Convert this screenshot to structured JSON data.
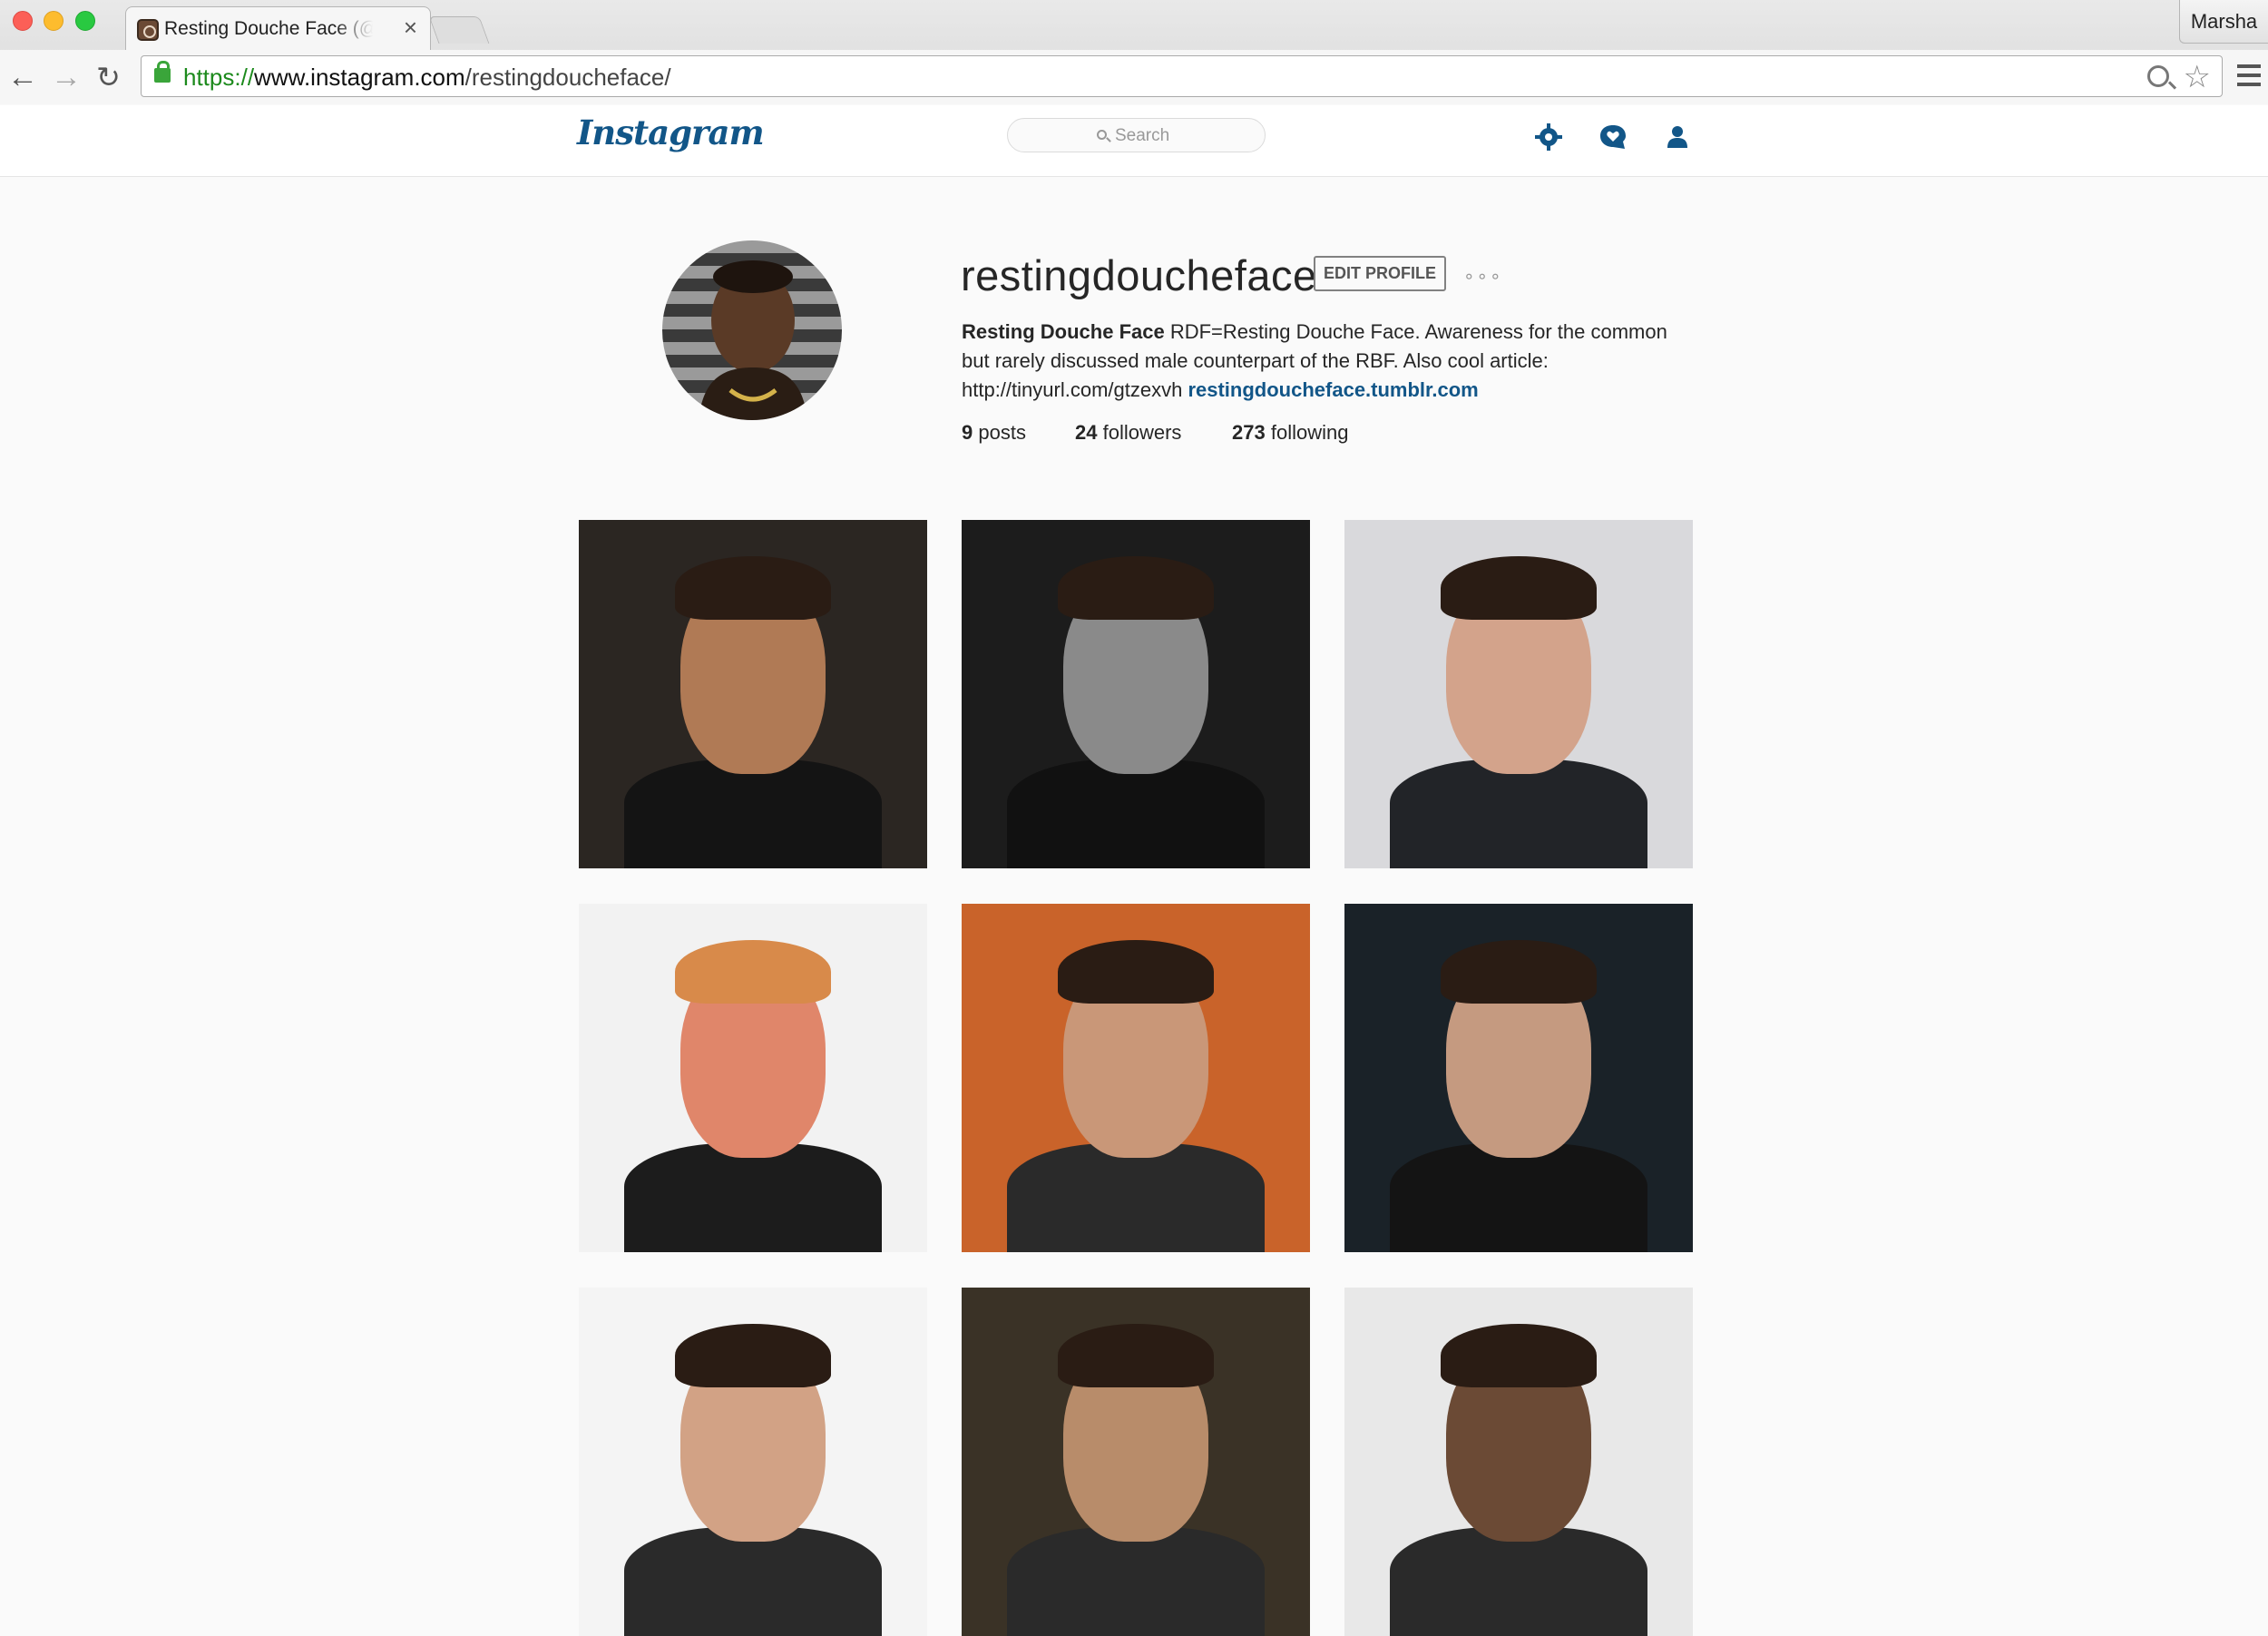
{
  "browser": {
    "tab_title": "Resting Douche Face (@restingdoucheface)",
    "tab_close": "×",
    "profile_name": "Marsha",
    "url": {
      "scheme": "https://",
      "host": "www.instagram.com",
      "path": "/restingdoucheface/"
    },
    "icons": [
      "back-icon",
      "forward-icon",
      "reload-icon",
      "lock-icon",
      "zoom-icon",
      "star-icon",
      "menu-icon"
    ]
  },
  "header": {
    "logo": "Instagram",
    "search_placeholder": "Search",
    "icons": [
      "explore-icon",
      "activity-icon",
      "profile-icon"
    ],
    "accent_color": "#125688"
  },
  "profile": {
    "username": "restingdoucheface",
    "edit_label": "EDIT PROFILE",
    "options": "∘∘∘",
    "bio_name": "Resting Douche Face",
    "bio_text": "RDF=Resting Douche Face. Awareness for the common but rarely discussed male counterpart of the RBF. Also cool article: http://tinyurl.com/gtzexvh",
    "bio_link": "restingdoucheface.tumblr.com",
    "stats": [
      {
        "count": "9",
        "label": "posts"
      },
      {
        "count": "24",
        "label": "followers"
      },
      {
        "count": "273",
        "label": "following"
      }
    ]
  },
  "posts": [
    {
      "name": "post-1",
      "bg": "#2b2622",
      "skin": "#b07a55",
      "suit": "#141414"
    },
    {
      "name": "post-2",
      "bg": "#1c1c1c",
      "skin": "#8a8a8a",
      "suit": "#111111"
    },
    {
      "name": "post-3",
      "bg": "#d9d9dc",
      "skin": "#d3a38b",
      "suit": "#222428"
    },
    {
      "name": "post-4",
      "bg": "#f2f2f2",
      "skin": "#e0866a",
      "suit": "#1c1c1c"
    },
    {
      "name": "post-5",
      "bg": "#c9632a",
      "skin": "#c99778",
      "suit": "#2a2a2a"
    },
    {
      "name": "post-6",
      "bg": "#1a2228",
      "skin": "#c59a80",
      "suit": "#141414"
    },
    {
      "name": "post-7",
      "bg": "#f4f4f4",
      "skin": "#d2a285",
      "suit": "#2a2a2a"
    },
    {
      "name": "post-8",
      "bg": "#3a3226",
      "skin": "#b88c6a",
      "suit": "#2a2a2a"
    },
    {
      "name": "post-9",
      "bg": "#e8e8e8",
      "skin": "#6b4a35",
      "suit": "#2a2a2a"
    }
  ]
}
